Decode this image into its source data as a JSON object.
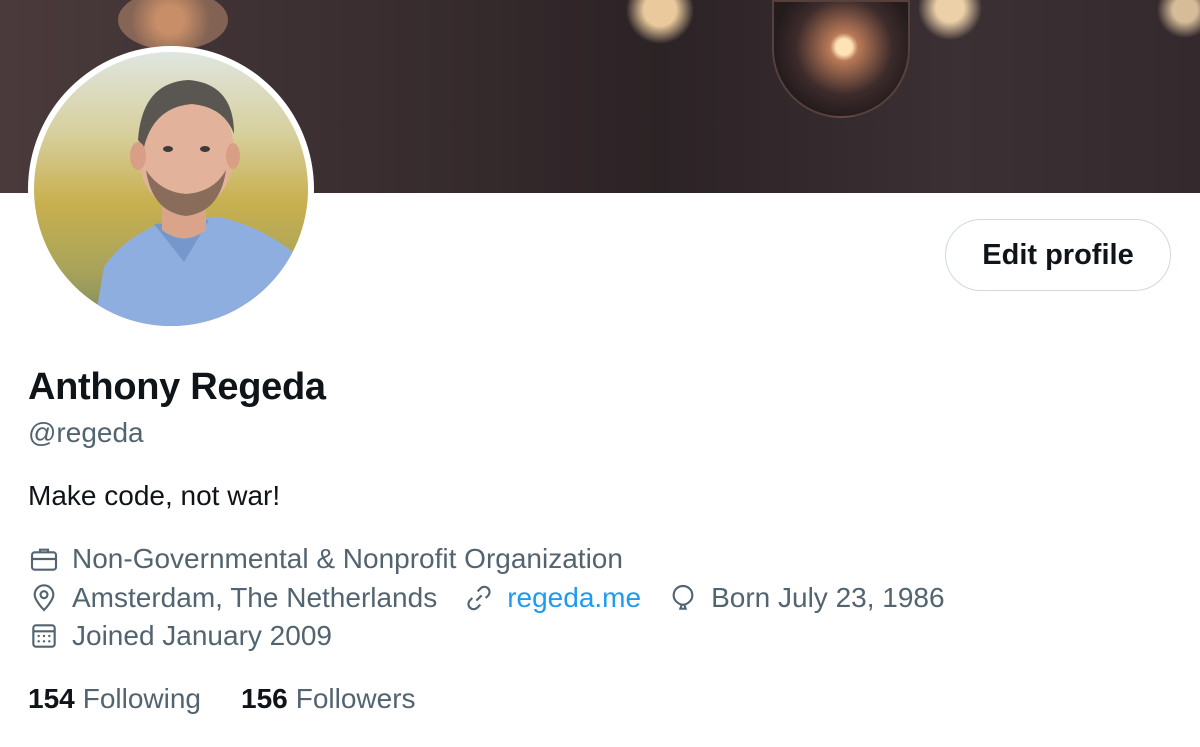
{
  "profile": {
    "name": "Anthony Regeda",
    "handle": "@regeda",
    "bio": "Make code, not war!",
    "category": "Non-Governmental & Nonprofit Organization",
    "location": "Amsterdam, The Netherlands",
    "website": "regeda.me",
    "birthday": "Born July 23, 1986",
    "joined": "Joined January 2009"
  },
  "actions": {
    "edit_label": "Edit profile"
  },
  "stats": {
    "following_count": "154",
    "following_label": "Following",
    "followers_count": "156",
    "followers_label": "Followers"
  },
  "icons": {
    "category": "briefcase-icon",
    "location": "location-pin-icon",
    "website": "link-icon",
    "birthday": "balloon-icon",
    "joined": "calendar-icon"
  },
  "colors": {
    "accent": "#1d9bf0",
    "secondary_text": "#536471",
    "primary_text": "#0f1419"
  }
}
